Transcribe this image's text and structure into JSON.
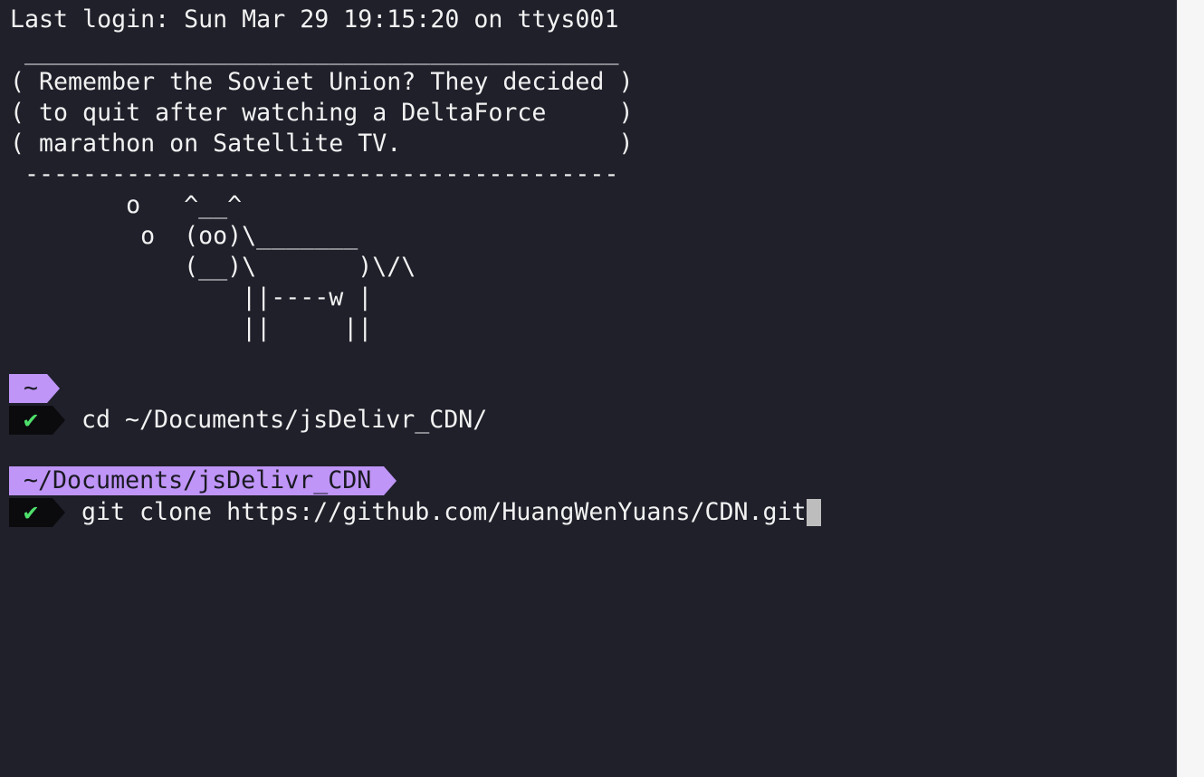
{
  "terminal": {
    "last_login": "Last login: Sun Mar 29 19:15:20 on ttys001",
    "cowsay": {
      "top_border": " _________________________________________",
      "lines": [
        "( Remember the Soviet Union? They decided )",
        "( to quit after watching a DeltaForce     )",
        "( marathon on Satellite TV.               )"
      ],
      "bottom_border": " -----------------------------------------",
      "cow": [
        "        o   ^__^",
        "         o  (oo)\\_______",
        "            (__)\\       )\\/\\",
        "                ||----w |",
        "                ||     ||"
      ]
    },
    "prompts": [
      {
        "directory": "~",
        "status": "✔",
        "command": "cd ~/Documents/jsDelivr_CDN/"
      },
      {
        "directory": "~/Documents/jsDelivr_CDN",
        "status": "✔",
        "command": "git clone https://github.com/HuangWenYuans/CDN.git"
      }
    ]
  },
  "colors": {
    "background": "#1f202a",
    "prompt_dir_bg": "#bf95f7",
    "status_bg": "#0b0b0e",
    "status_ok": "#4ee06b",
    "cursor": "#bdbdbd"
  }
}
